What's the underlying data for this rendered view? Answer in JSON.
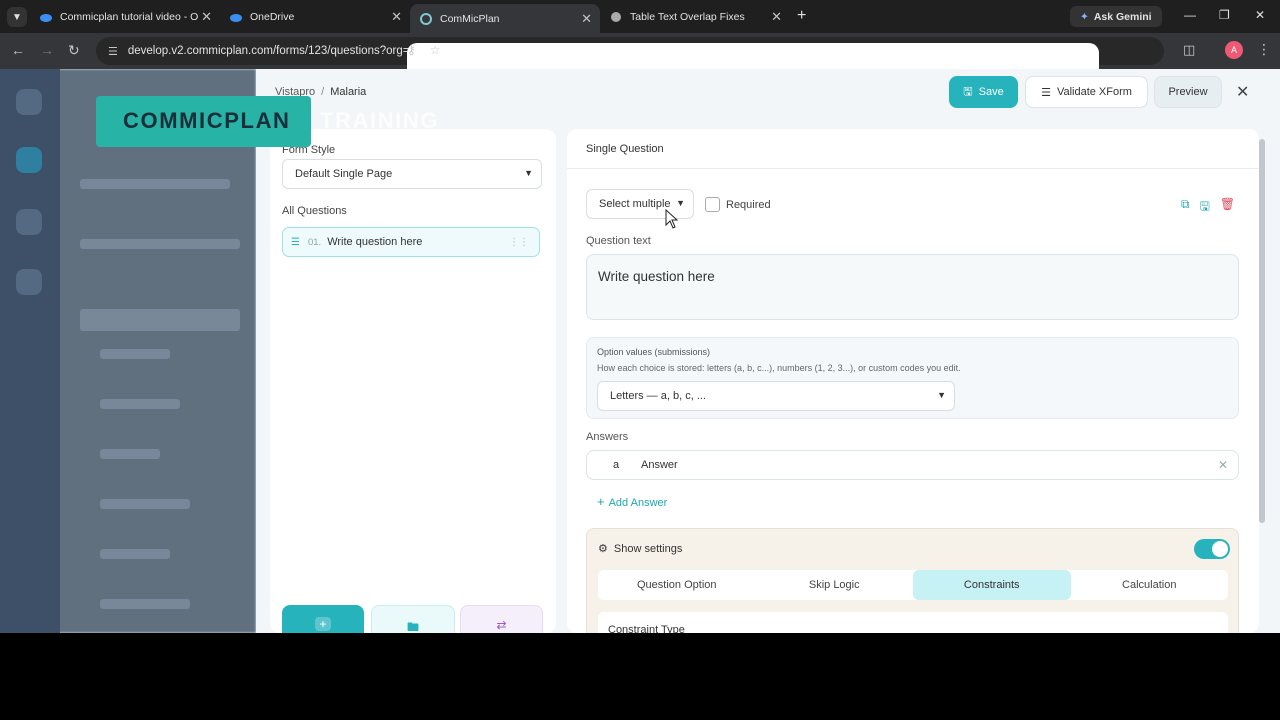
{
  "browser": {
    "tabs": [
      {
        "title": "Commicplan tutorial video - O"
      },
      {
        "title": "OneDrive"
      },
      {
        "title": "ComMicPlan"
      },
      {
        "title": "Table Text Overlap Fixes"
      }
    ],
    "ask_gemini": "Ask Gemini",
    "url": "develop.v2.commicplan.com/forms/123/questions?org=32&project=15",
    "profile_initial": "A"
  },
  "overlay": {
    "brand": "COMMICPLAN",
    "suffix": "TRAINING"
  },
  "header": {
    "breadcrumb": [
      "Vistapro",
      "Malaria"
    ],
    "save_label": "Save",
    "validate_label": "Validate XForm",
    "preview_label": "Preview"
  },
  "left_panel": {
    "form_style_label": "Form Style",
    "form_style_value": "Default Single Page",
    "all_questions_label": "All Questions",
    "questions": [
      {
        "num": "01.",
        "text": "Write question here"
      }
    ]
  },
  "editor": {
    "title": "Single Question",
    "type_value": "Select multiple",
    "required_label": "Required",
    "question_text_label": "Question text",
    "question_text_value": "Write question here",
    "option_values_title": "Option values (submissions)",
    "option_values_help": "How each choice is stored: letters (a, b, c...), numbers (1, 2, 3...), or custom codes you edit.",
    "option_values_value": "Letters — a, b, c, ...",
    "answers_label": "Answers",
    "answers": [
      {
        "letter": "a",
        "text": "Answer"
      }
    ],
    "add_answer_label": "Add Answer",
    "show_settings_label": "Show settings",
    "settings_tabs": [
      {
        "label": "Question Option"
      },
      {
        "label": "Skip Logic"
      },
      {
        "label": "Constraints"
      },
      {
        "label": "Calculation"
      }
    ],
    "constraint_type_label": "Constraint Type"
  },
  "colors": {
    "accent": "#27b3bc",
    "overlay": "#27b3a6",
    "active_tab": "#c6f1f5"
  }
}
